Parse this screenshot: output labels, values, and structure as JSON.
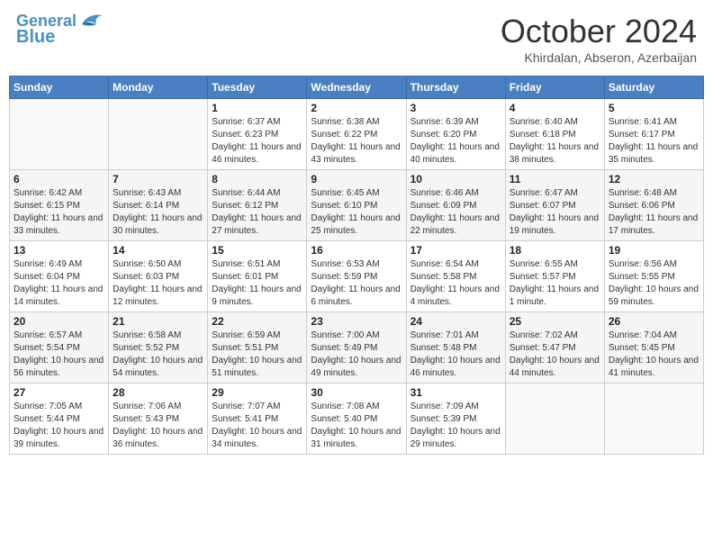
{
  "header": {
    "logo_line1": "General",
    "logo_line2": "Blue",
    "month": "October 2024",
    "location": "Khirdalan, Abseron, Azerbaijan"
  },
  "weekdays": [
    "Sunday",
    "Monday",
    "Tuesday",
    "Wednesday",
    "Thursday",
    "Friday",
    "Saturday"
  ],
  "rows": [
    [
      {
        "num": "",
        "info": ""
      },
      {
        "num": "",
        "info": ""
      },
      {
        "num": "1",
        "info": "Sunrise: 6:37 AM\nSunset: 6:23 PM\nDaylight: 11 hours and 46 minutes."
      },
      {
        "num": "2",
        "info": "Sunrise: 6:38 AM\nSunset: 6:22 PM\nDaylight: 11 hours and 43 minutes."
      },
      {
        "num": "3",
        "info": "Sunrise: 6:39 AM\nSunset: 6:20 PM\nDaylight: 11 hours and 40 minutes."
      },
      {
        "num": "4",
        "info": "Sunrise: 6:40 AM\nSunset: 6:18 PM\nDaylight: 11 hours and 38 minutes."
      },
      {
        "num": "5",
        "info": "Sunrise: 6:41 AM\nSunset: 6:17 PM\nDaylight: 11 hours and 35 minutes."
      }
    ],
    [
      {
        "num": "6",
        "info": "Sunrise: 6:42 AM\nSunset: 6:15 PM\nDaylight: 11 hours and 33 minutes."
      },
      {
        "num": "7",
        "info": "Sunrise: 6:43 AM\nSunset: 6:14 PM\nDaylight: 11 hours and 30 minutes."
      },
      {
        "num": "8",
        "info": "Sunrise: 6:44 AM\nSunset: 6:12 PM\nDaylight: 11 hours and 27 minutes."
      },
      {
        "num": "9",
        "info": "Sunrise: 6:45 AM\nSunset: 6:10 PM\nDaylight: 11 hours and 25 minutes."
      },
      {
        "num": "10",
        "info": "Sunrise: 6:46 AM\nSunset: 6:09 PM\nDaylight: 11 hours and 22 minutes."
      },
      {
        "num": "11",
        "info": "Sunrise: 6:47 AM\nSunset: 6:07 PM\nDaylight: 11 hours and 19 minutes."
      },
      {
        "num": "12",
        "info": "Sunrise: 6:48 AM\nSunset: 6:06 PM\nDaylight: 11 hours and 17 minutes."
      }
    ],
    [
      {
        "num": "13",
        "info": "Sunrise: 6:49 AM\nSunset: 6:04 PM\nDaylight: 11 hours and 14 minutes."
      },
      {
        "num": "14",
        "info": "Sunrise: 6:50 AM\nSunset: 6:03 PM\nDaylight: 11 hours and 12 minutes."
      },
      {
        "num": "15",
        "info": "Sunrise: 6:51 AM\nSunset: 6:01 PM\nDaylight: 11 hours and 9 minutes."
      },
      {
        "num": "16",
        "info": "Sunrise: 6:53 AM\nSunset: 5:59 PM\nDaylight: 11 hours and 6 minutes."
      },
      {
        "num": "17",
        "info": "Sunrise: 6:54 AM\nSunset: 5:58 PM\nDaylight: 11 hours and 4 minutes."
      },
      {
        "num": "18",
        "info": "Sunrise: 6:55 AM\nSunset: 5:57 PM\nDaylight: 11 hours and 1 minute."
      },
      {
        "num": "19",
        "info": "Sunrise: 6:56 AM\nSunset: 5:55 PM\nDaylight: 10 hours and 59 minutes."
      }
    ],
    [
      {
        "num": "20",
        "info": "Sunrise: 6:57 AM\nSunset: 5:54 PM\nDaylight: 10 hours and 56 minutes."
      },
      {
        "num": "21",
        "info": "Sunrise: 6:58 AM\nSunset: 5:52 PM\nDaylight: 10 hours and 54 minutes."
      },
      {
        "num": "22",
        "info": "Sunrise: 6:59 AM\nSunset: 5:51 PM\nDaylight: 10 hours and 51 minutes."
      },
      {
        "num": "23",
        "info": "Sunrise: 7:00 AM\nSunset: 5:49 PM\nDaylight: 10 hours and 49 minutes."
      },
      {
        "num": "24",
        "info": "Sunrise: 7:01 AM\nSunset: 5:48 PM\nDaylight: 10 hours and 46 minutes."
      },
      {
        "num": "25",
        "info": "Sunrise: 7:02 AM\nSunset: 5:47 PM\nDaylight: 10 hours and 44 minutes."
      },
      {
        "num": "26",
        "info": "Sunrise: 7:04 AM\nSunset: 5:45 PM\nDaylight: 10 hours and 41 minutes."
      }
    ],
    [
      {
        "num": "27",
        "info": "Sunrise: 7:05 AM\nSunset: 5:44 PM\nDaylight: 10 hours and 39 minutes."
      },
      {
        "num": "28",
        "info": "Sunrise: 7:06 AM\nSunset: 5:43 PM\nDaylight: 10 hours and 36 minutes."
      },
      {
        "num": "29",
        "info": "Sunrise: 7:07 AM\nSunset: 5:41 PM\nDaylight: 10 hours and 34 minutes."
      },
      {
        "num": "30",
        "info": "Sunrise: 7:08 AM\nSunset: 5:40 PM\nDaylight: 10 hours and 31 minutes."
      },
      {
        "num": "31",
        "info": "Sunrise: 7:09 AM\nSunset: 5:39 PM\nDaylight: 10 hours and 29 minutes."
      },
      {
        "num": "",
        "info": ""
      },
      {
        "num": "",
        "info": ""
      }
    ]
  ]
}
